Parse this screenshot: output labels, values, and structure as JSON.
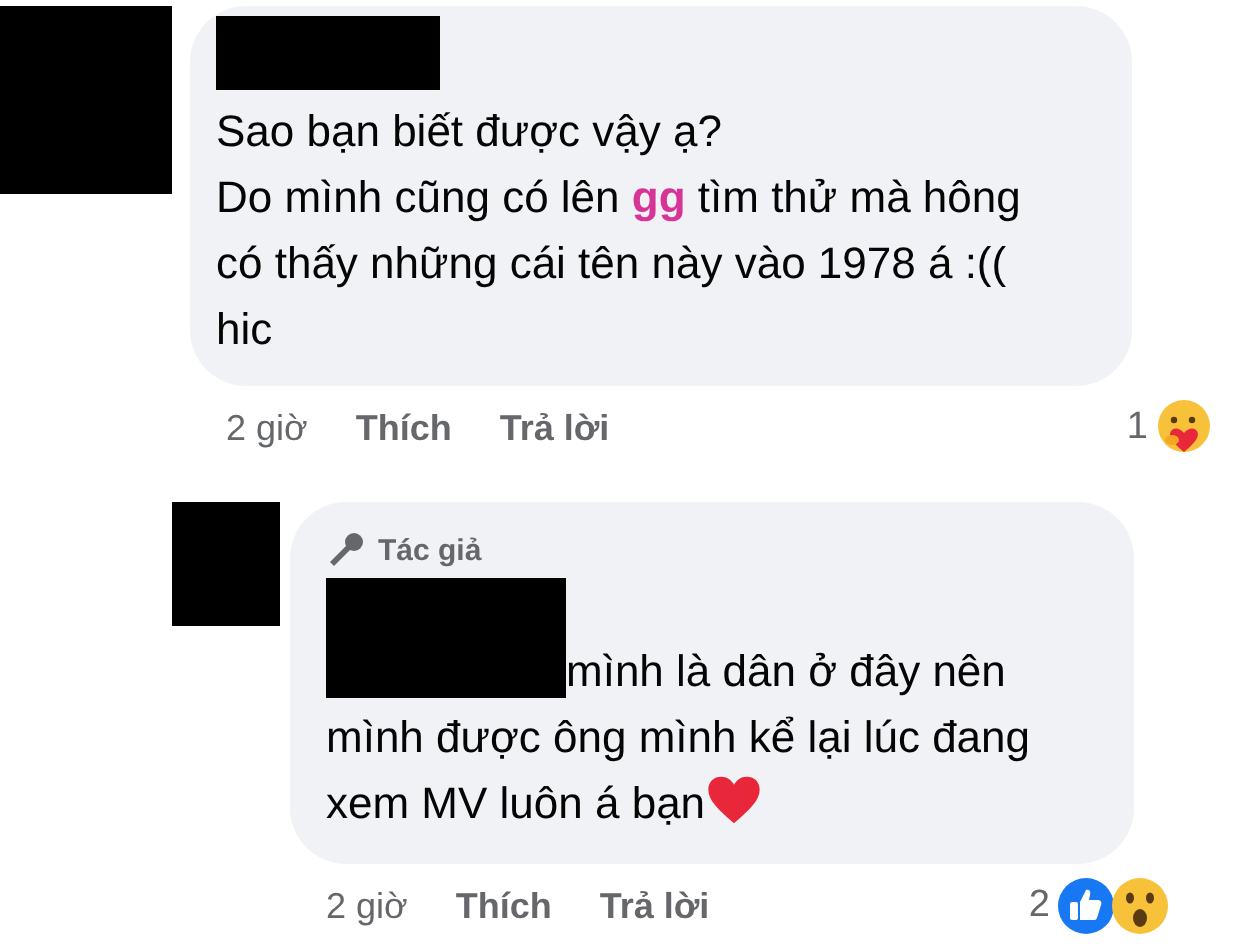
{
  "comments": [
    {
      "text": "Sao bạn biết được vậy ạ?\nDo mình cũng có lên **gg** tìm thử mà hông có thấy những cái tên này vào 1978 á :(( hic",
      "ends_with_heart": false,
      "time": "2 giờ",
      "like_label": "Thích",
      "reply_label": "Trả lời",
      "reaction_count": "1",
      "reactions": [
        {
          "kind": "care"
        }
      ]
    },
    {
      "badge": "Tác giả",
      "text": "mình là dân ở đây nên mình được ông mình kể lại lúc đang xem MV luôn á bạn",
      "ends_with_heart": true,
      "time": "2 giờ",
      "like_label": "Thích",
      "reply_label": "Trả lời",
      "reaction_count": "2",
      "reactions": [
        {
          "kind": "like"
        },
        {
          "kind": "wow"
        }
      ]
    }
  ]
}
